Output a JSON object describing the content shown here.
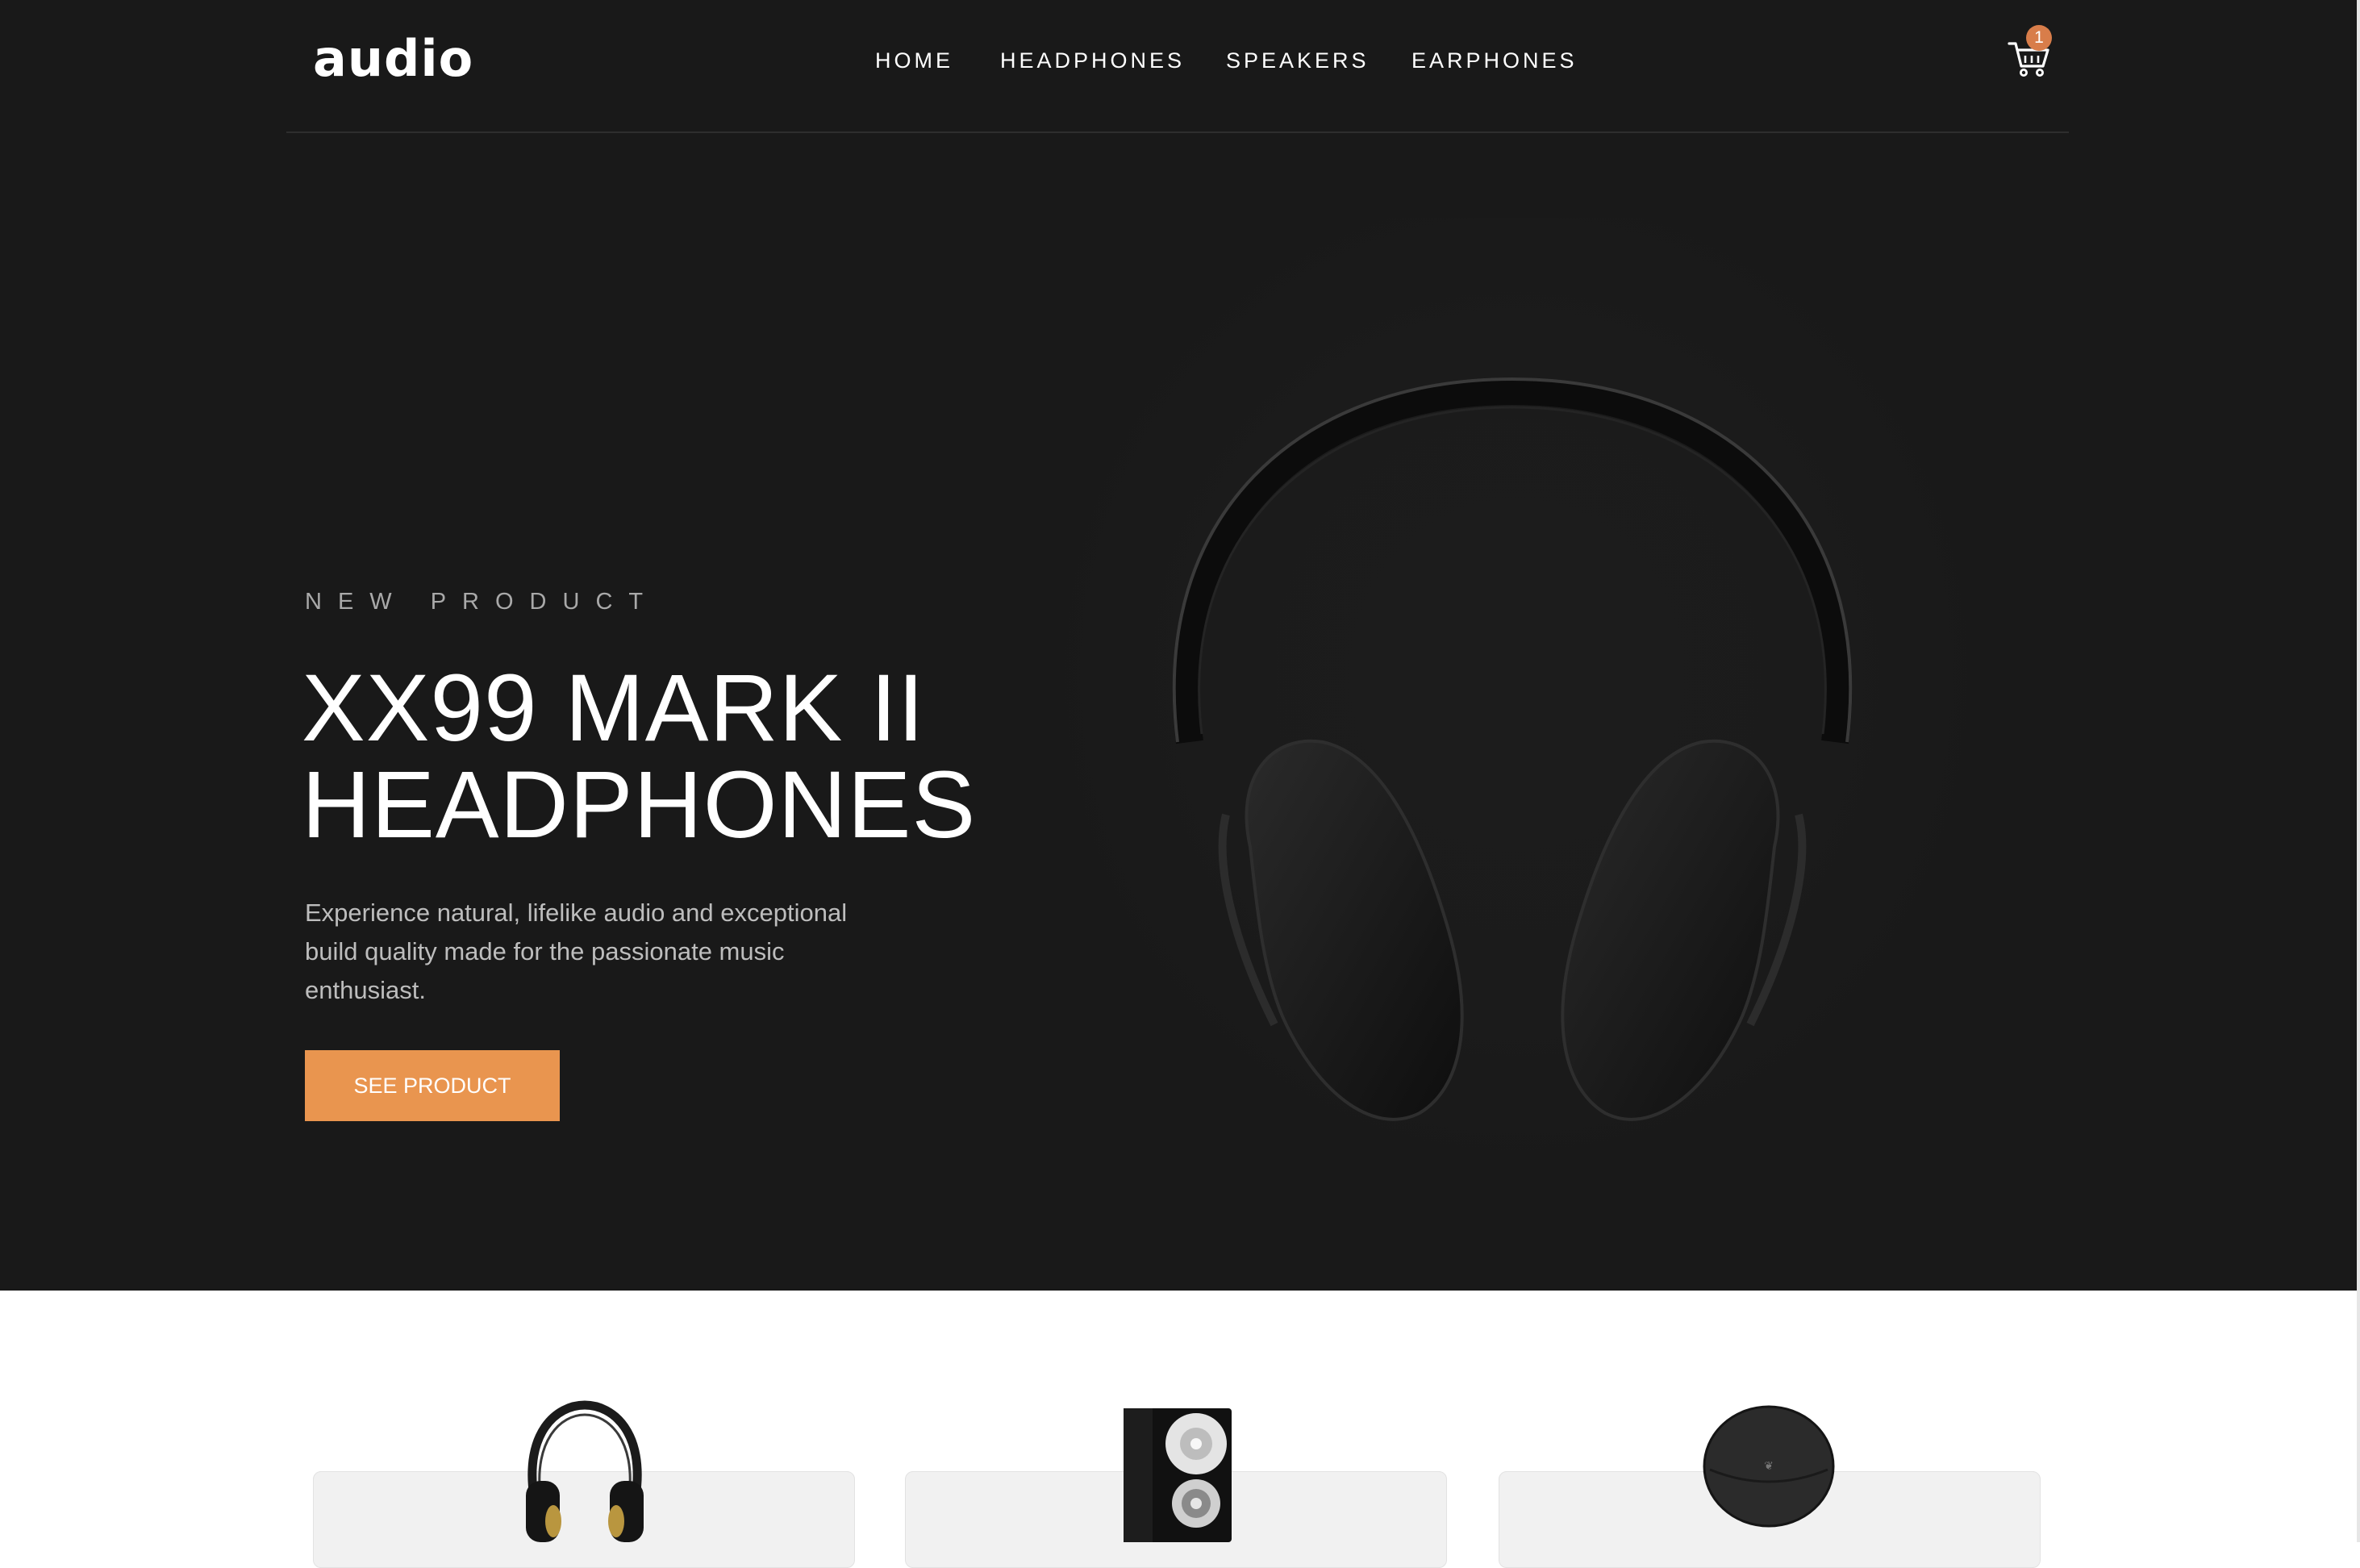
{
  "header": {
    "logo": "audio",
    "nav": [
      {
        "label": "HOME"
      },
      {
        "label": "HEADPHONES"
      },
      {
        "label": "SPEAKERS"
      },
      {
        "label": "EARPHONES"
      }
    ],
    "cart": {
      "icon": "cart-icon",
      "count": "1"
    }
  },
  "hero": {
    "overline": "NEW PRODUCT",
    "title_line1": "XX99 MARK II",
    "title_line2": "HEADPHONES",
    "description": "Experience natural, lifelike audio and exceptional build quality made for the passionate music enthusiast.",
    "cta_label": "SEE PRODUCT",
    "image": "headphones-image"
  },
  "categories": [
    {
      "image": "headphones-thumbnail"
    },
    {
      "image": "speaker-thumbnail"
    },
    {
      "image": "earphones-thumbnail"
    }
  ],
  "colors": {
    "hero_bg": "#191919",
    "accent": "#D87D4A",
    "button": "#E9954F",
    "card_bg": "#F1F1F1"
  }
}
